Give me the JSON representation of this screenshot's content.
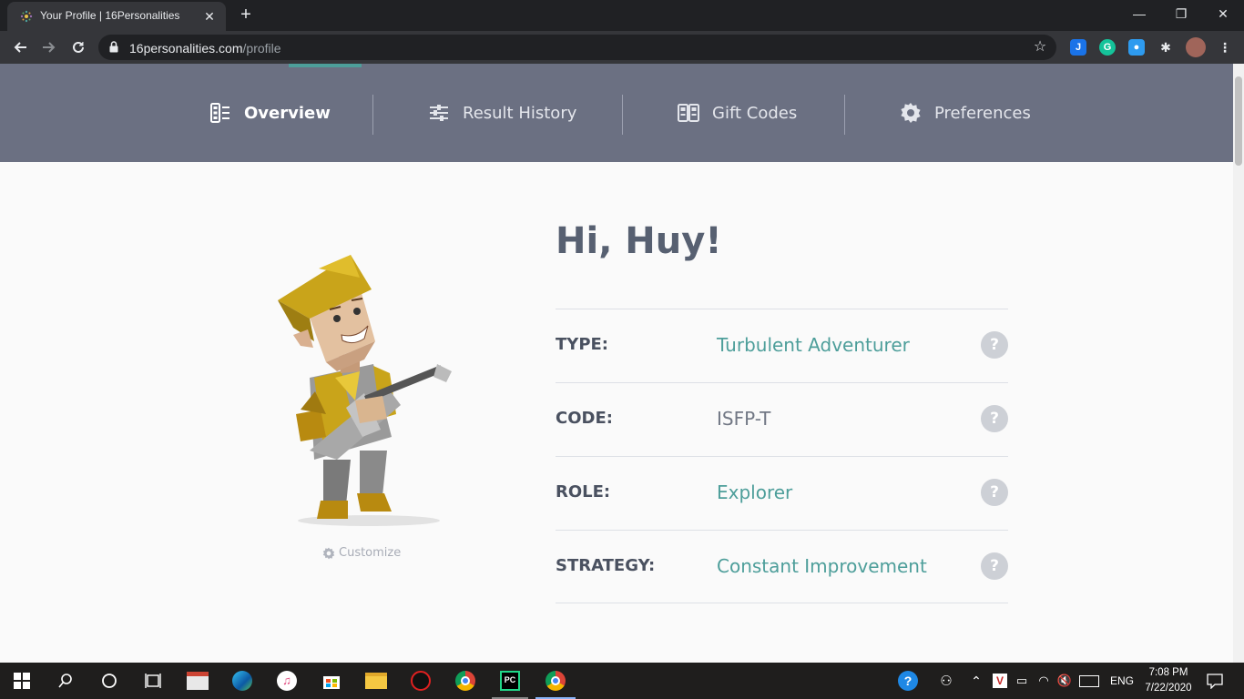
{
  "browser": {
    "tab_title": "Your Profile | 16Personalities",
    "url_host": "16personalities.com",
    "url_path": "/profile",
    "minimize": "—",
    "restore": "❐",
    "close": "✕",
    "tab_close": "✕",
    "new_tab": "+"
  },
  "profile_nav": {
    "items": [
      {
        "label": "Overview",
        "icon": "overview-icon",
        "active": true
      },
      {
        "label": "Result History",
        "icon": "sliders-icon",
        "active": false
      },
      {
        "label": "Gift Codes",
        "icon": "gift-codes-icon",
        "active": false
      },
      {
        "label": "Preferences",
        "icon": "gear-icon",
        "active": false
      }
    ]
  },
  "greeting": "Hi, Huy!",
  "customize_label": "Customize",
  "info": [
    {
      "label": "TYPE:",
      "value": "Turbulent Adventurer",
      "link": true
    },
    {
      "label": "CODE:",
      "value": "ISFP-T",
      "link": false
    },
    {
      "label": "ROLE:",
      "value": "Explorer",
      "link": true
    },
    {
      "label": "STRATEGY:",
      "value": "Constant Improvement",
      "link": true
    }
  ],
  "help_glyph": "?",
  "colors": {
    "nav_bg": "#6b7082",
    "accent": "#4d9e9a",
    "heading": "#576071"
  },
  "taskbar": {
    "language": "ENG",
    "time": "7:08 PM",
    "date": "7/22/2020"
  }
}
